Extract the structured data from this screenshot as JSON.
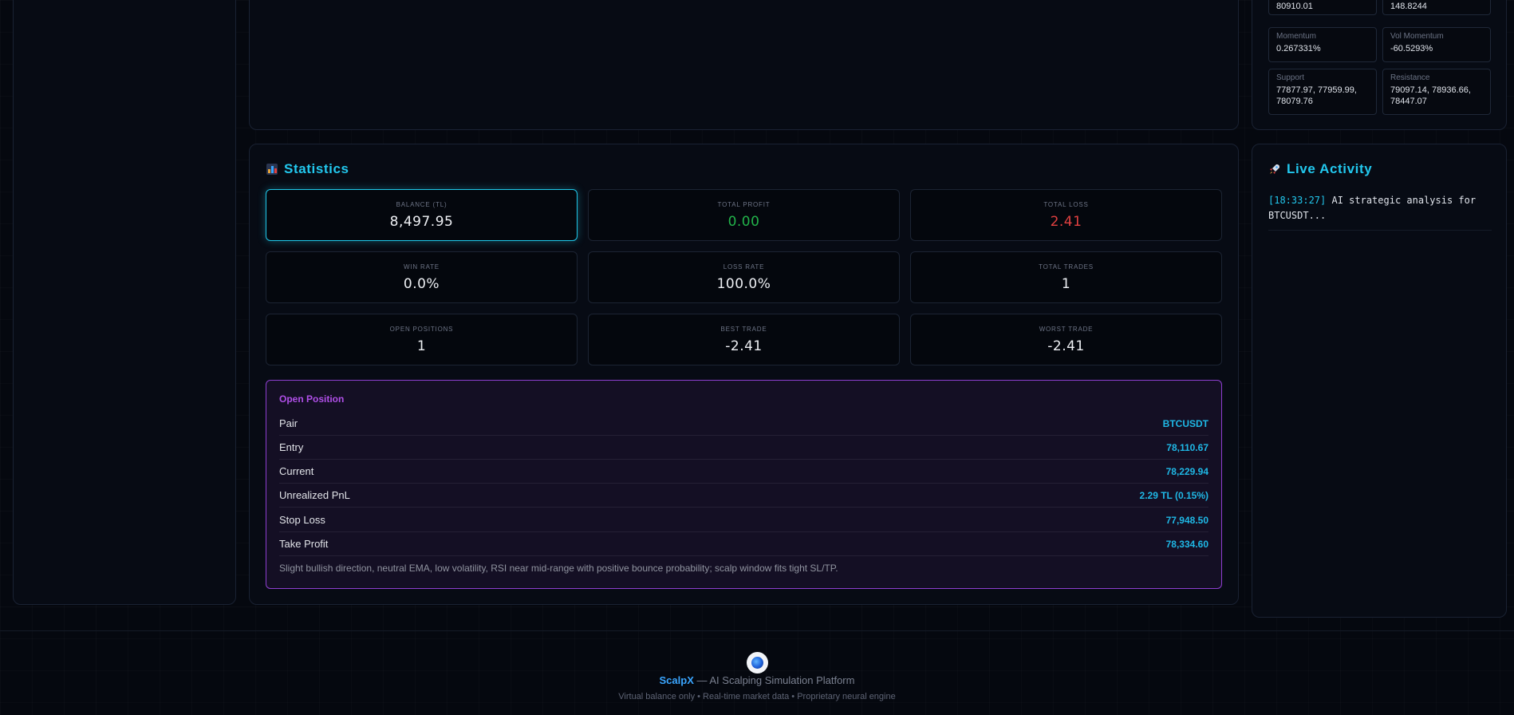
{
  "indicators": {
    "top_left_value": "80910.01",
    "top_right_value": "148.8244",
    "momentum": {
      "label": "Momentum",
      "value": "0.267331%"
    },
    "vol_momentum": {
      "label": "Vol Momentum",
      "value": "-60.5293%"
    },
    "support": {
      "label": "Support",
      "value": "77877.97, 77959.99, 78079.76"
    },
    "resistance": {
      "label": "Resistance",
      "value": "79097.14, 78936.66, 78447.07"
    }
  },
  "statistics": {
    "title": "Statistics",
    "icon": "bar-chart-icon",
    "cards": [
      {
        "label": "BALANCE (TL)",
        "value": "8,497.95"
      },
      {
        "label": "TOTAL PROFIT",
        "value": "0.00"
      },
      {
        "label": "TOTAL LOSS",
        "value": "2.41"
      },
      {
        "label": "WIN RATE",
        "value": "0.0%"
      },
      {
        "label": "LOSS RATE",
        "value": "100.0%"
      },
      {
        "label": "TOTAL TRADES",
        "value": "1"
      },
      {
        "label": "OPEN POSITIONS",
        "value": "1"
      },
      {
        "label": "BEST TRADE",
        "value": "-2.41"
      },
      {
        "label": "WORST TRADE",
        "value": "-2.41"
      }
    ],
    "colors": {
      "profit": "#22b34a",
      "loss": "#e04040",
      "accent": "#22c8ee"
    }
  },
  "open_position": {
    "title": "Open Position",
    "rows": [
      {
        "key": "Pair",
        "value": "BTCUSDT"
      },
      {
        "key": "Entry",
        "value": "78,110.67"
      },
      {
        "key": "Current",
        "value": "78,229.94"
      },
      {
        "key": "Unrealized PnL",
        "value": "2.29 TL (0.15%)"
      },
      {
        "key": "Stop Loss",
        "value": "77,948.50"
      },
      {
        "key": "Take Profit",
        "value": "78,334.60"
      }
    ],
    "note": "Slight bullish direction, neutral EMA, low volatility, RSI near mid-range with positive bounce probability; scalp window fits tight SL/TP."
  },
  "activity": {
    "title": "Live Activity",
    "icon": "rocket-icon",
    "entries": [
      {
        "time": "[18:33:27]",
        "text": "AI strategic analysis for BTCUSDT..."
      }
    ]
  },
  "footer": {
    "brand": "ScalpX",
    "tagline": " — AI Scalping Simulation Platform",
    "sub": "Virtual balance only • Real-time market data • Proprietary neural engine"
  }
}
